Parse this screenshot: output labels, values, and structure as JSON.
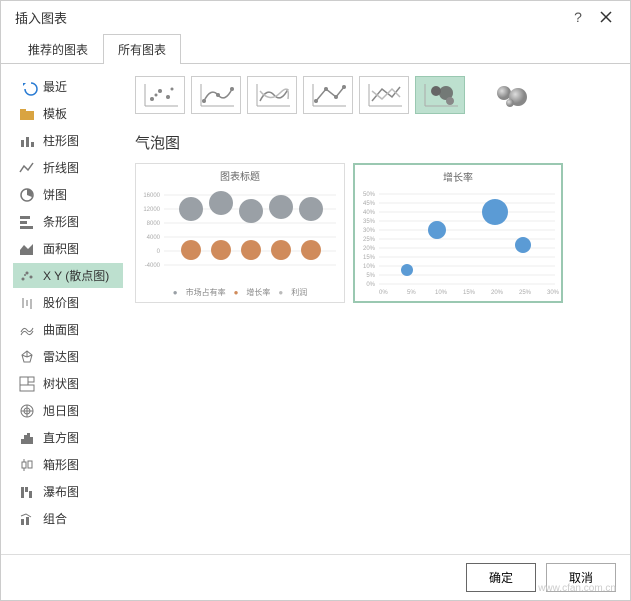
{
  "dialog": {
    "title": "插入图表"
  },
  "tabs": [
    {
      "label": "推荐的图表",
      "active": false
    },
    {
      "label": "所有图表",
      "active": true
    }
  ],
  "sidebar": {
    "items": [
      {
        "name": "recent",
        "label": "最近",
        "icon": "undo-icon",
        "color": "#2b7cd3"
      },
      {
        "name": "template",
        "label": "模板",
        "icon": "folder-icon",
        "color": "#d9a441"
      },
      {
        "name": "column",
        "label": "柱形图",
        "icon": "column-icon",
        "color": "#777"
      },
      {
        "name": "line",
        "label": "折线图",
        "icon": "line-icon",
        "color": "#777"
      },
      {
        "name": "pie",
        "label": "饼图",
        "icon": "pie-icon",
        "color": "#777"
      },
      {
        "name": "bar",
        "label": "条形图",
        "icon": "bar-icon",
        "color": "#777"
      },
      {
        "name": "area",
        "label": "面积图",
        "icon": "area-icon",
        "color": "#777"
      },
      {
        "name": "scatter",
        "label": "X Y (散点图)",
        "icon": "scatter-icon",
        "color": "#777",
        "selected": true
      },
      {
        "name": "stock",
        "label": "股价图",
        "icon": "stock-icon",
        "color": "#777"
      },
      {
        "name": "surface",
        "label": "曲面图",
        "icon": "surface-icon",
        "color": "#777"
      },
      {
        "name": "radar",
        "label": "雷达图",
        "icon": "radar-icon",
        "color": "#777"
      },
      {
        "name": "treemap",
        "label": "树状图",
        "icon": "treemap-icon",
        "color": "#777"
      },
      {
        "name": "sunburst",
        "label": "旭日图",
        "icon": "sunburst-icon",
        "color": "#777"
      },
      {
        "name": "histogram",
        "label": "直方图",
        "icon": "histogram-icon",
        "color": "#777"
      },
      {
        "name": "box",
        "label": "箱形图",
        "icon": "box-icon",
        "color": "#777"
      },
      {
        "name": "waterfall",
        "label": "瀑布图",
        "icon": "waterfall-icon",
        "color": "#777"
      },
      {
        "name": "combo",
        "label": "组合",
        "icon": "combo-icon",
        "color": "#777"
      }
    ]
  },
  "main": {
    "chart_type_title": "气泡图",
    "subtypes": [
      {
        "name": "scatter-dots",
        "selected": false
      },
      {
        "name": "scatter-smooth-markers",
        "selected": false
      },
      {
        "name": "scatter-smooth",
        "selected": false
      },
      {
        "name": "scatter-straight-markers",
        "selected": false
      },
      {
        "name": "scatter-straight",
        "selected": false
      },
      {
        "name": "bubble",
        "selected": true
      },
      {
        "name": "bubble-3d",
        "selected": false,
        "gap": true
      }
    ],
    "previews": [
      {
        "title": "图表标题",
        "legend": [
          "市场占有率",
          "增长率",
          "利润"
        ],
        "selected": false
      },
      {
        "title": "增长率",
        "selected": true
      }
    ]
  },
  "footer": {
    "ok": "确定",
    "cancel": "取消"
  },
  "watermark": "www.cfan.com.cn",
  "chart_data": [
    {
      "type": "bubble",
      "title": "图表标题",
      "ylim": [
        -4000,
        16000
      ],
      "yticks": [
        -4000,
        0,
        4000,
        8000,
        12000,
        16000
      ],
      "series": [
        {
          "name": "市场占有率",
          "color": "#9aa0a6",
          "points": [
            [
              1,
              12000,
              12
            ],
            [
              2,
              14000,
              12
            ],
            [
              3,
              11000,
              12
            ],
            [
              4,
              12500,
              12
            ],
            [
              5,
              12000,
              12
            ]
          ]
        },
        {
          "name": "增长率",
          "color": "#d08b5b",
          "points": [
            [
              1,
              200,
              10
            ],
            [
              2,
              200,
              10
            ],
            [
              3,
              200,
              10
            ],
            [
              4,
              200,
              10
            ],
            [
              5,
              200,
              10
            ]
          ]
        },
        {
          "name": "利润",
          "color": "#bbb",
          "points": [
            [
              3,
              -2500,
              6
            ]
          ]
        }
      ]
    },
    {
      "type": "bubble",
      "title": "增长率",
      "xlim": [
        0,
        30
      ],
      "ylim": [
        0,
        50
      ],
      "xticks": [
        0,
        5,
        10,
        15,
        20,
        25,
        30
      ],
      "yticks": [
        0,
        5,
        10,
        15,
        20,
        25,
        30,
        35,
        40,
        45,
        50
      ],
      "series": [
        {
          "name": "",
          "color": "#5b9bd5",
          "points": [
            [
              5,
              8,
              6
            ],
            [
              10,
              30,
              9
            ],
            [
              20,
              40,
              12
            ],
            [
              25,
              22,
              8
            ]
          ]
        }
      ]
    }
  ]
}
